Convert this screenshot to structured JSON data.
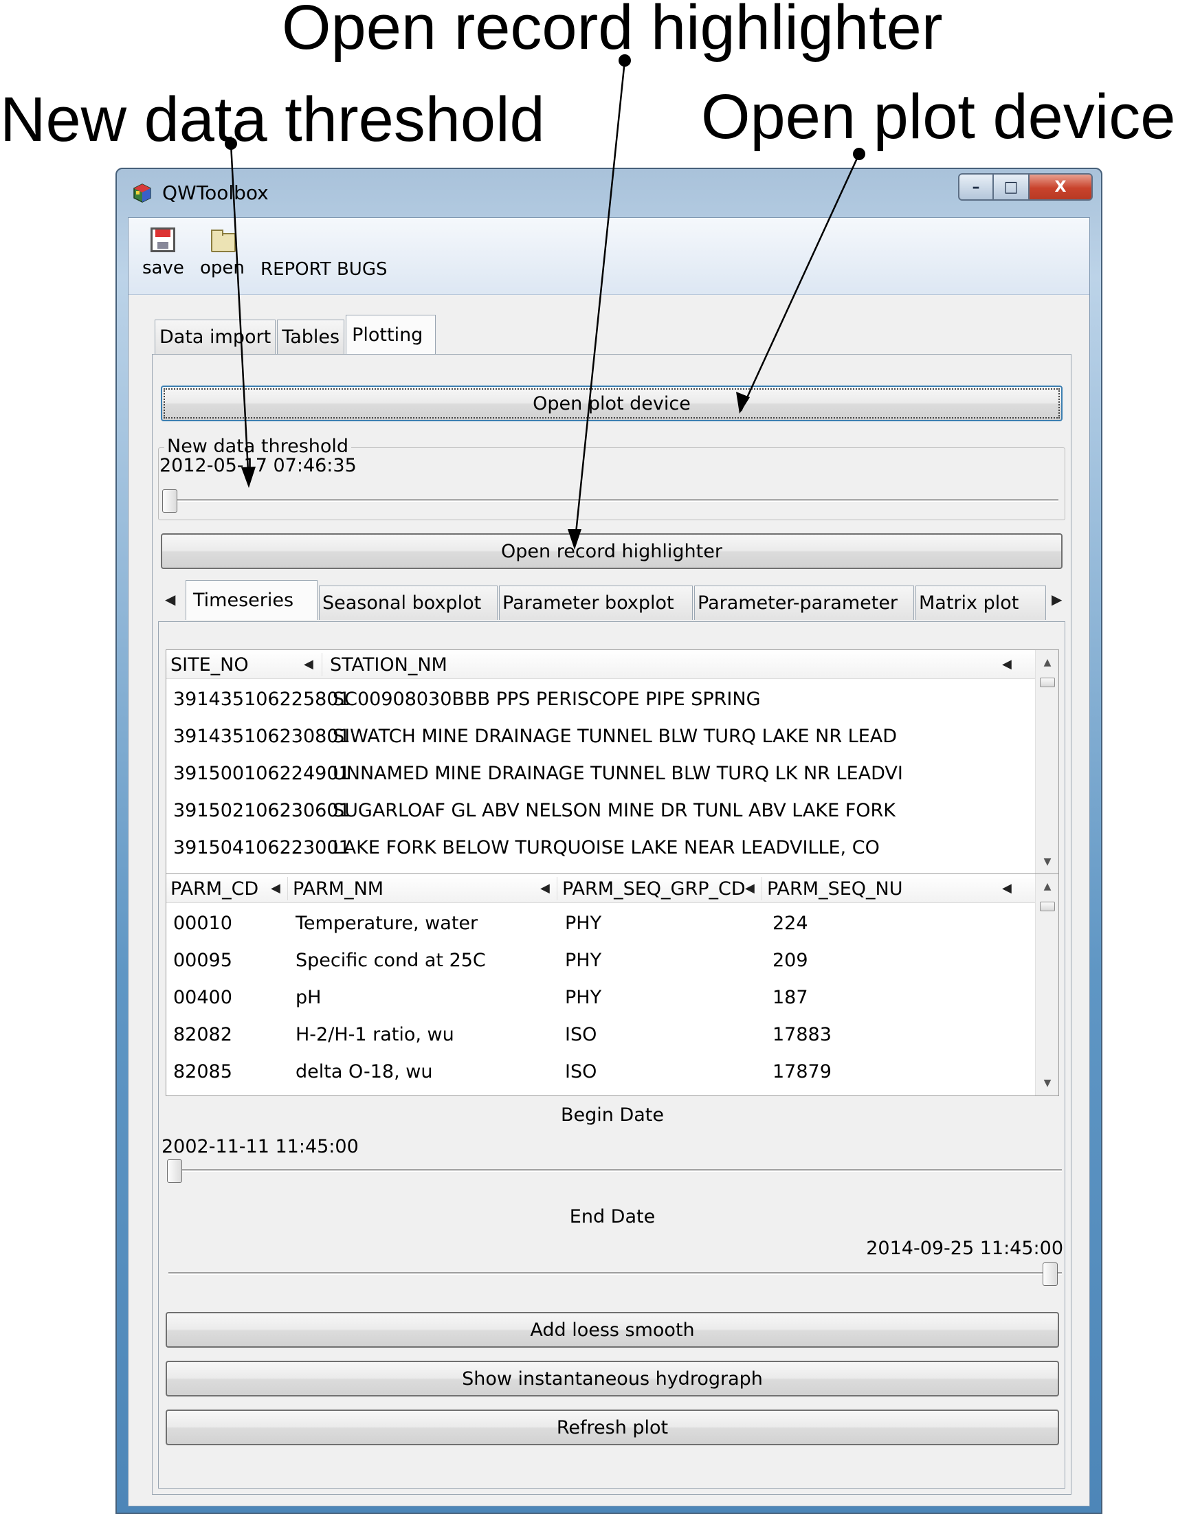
{
  "annotations": {
    "record_highlighter": "Open record highlighter",
    "data_threshold": "New data threshold",
    "plot_device": "Open plot device"
  },
  "window": {
    "title": "QWToolbox",
    "controls": {
      "minimize": "–",
      "maximize": "□",
      "close": "X"
    }
  },
  "toolbar": {
    "save_label": "save",
    "open_label": "open",
    "report_bugs_label": "REPORT BUGS"
  },
  "main_tabs": [
    {
      "label": "Data import"
    },
    {
      "label": "Tables"
    },
    {
      "label": "Plotting",
      "active": true
    }
  ],
  "plotting": {
    "open_plot_device_label": "Open plot device",
    "threshold": {
      "title": "New data threshold",
      "value": "2012-05-17 07:46:35"
    },
    "open_record_highlighter_label": "Open record highlighter",
    "plot_tabs": [
      {
        "label": "Timeseries",
        "active": true
      },
      {
        "label": "Seasonal boxplot"
      },
      {
        "label": "Parameter boxplot"
      },
      {
        "label": "Parameter-parameter"
      },
      {
        "label": "Matrix plot"
      }
    ],
    "sites_table": {
      "columns": [
        "SITE_NO",
        "STATION_NM"
      ],
      "rows": [
        [
          "391435106225801",
          "SC00908030BBB PPS PERISCOPE PIPE SPRING"
        ],
        [
          "391435106230801",
          "SIWATCH MINE DRAINAGE TUNNEL BLW TURQ LAKE NR LEAD"
        ],
        [
          "391500106224901",
          "UNNAMED MINE DRAINAGE TUNNEL BLW TURQ LK NR LEADVI"
        ],
        [
          "391502106230601",
          "SUGARLOAF GL ABV NELSON MINE DR TUNL ABV LAKE FORK"
        ],
        [
          "391504106223001",
          "LAKE FORK BELOW TURQUOISE LAKE NEAR LEADVILLE, CO"
        ]
      ]
    },
    "params_table": {
      "columns": [
        "PARM_CD",
        "PARM_NM",
        "PARM_SEQ_GRP_CD",
        "PARM_SEQ_NU"
      ],
      "rows": [
        [
          "00010",
          "Temperature, water",
          "PHY",
          "224"
        ],
        [
          "00095",
          "Specific cond at 25C",
          "PHY",
          "209"
        ],
        [
          "00400",
          "pH",
          "PHY",
          "187"
        ],
        [
          "82082",
          "H-2/H-1 ratio, wu",
          "ISO",
          "17883"
        ],
        [
          "82085",
          "delta O-18, wu",
          "ISO",
          "17879"
        ]
      ]
    },
    "begin_date": {
      "label": "Begin Date",
      "value": "2002-11-11 11:45:00"
    },
    "end_date": {
      "label": "End Date",
      "value": "2014-09-25 11:45:00"
    },
    "add_loess_label": "Add loess smooth",
    "show_hydrograph_label": "Show instantaneous hydrograph",
    "refresh_plot_label": "Refresh plot"
  },
  "colors": {
    "window_frame": "#5f96c4",
    "close_button": "#c9432c",
    "client_bg": "#f0f0f0"
  },
  "icons": {
    "app": "app-cube-icon",
    "save": "floppy-disk-icon",
    "open": "folder-icon"
  }
}
